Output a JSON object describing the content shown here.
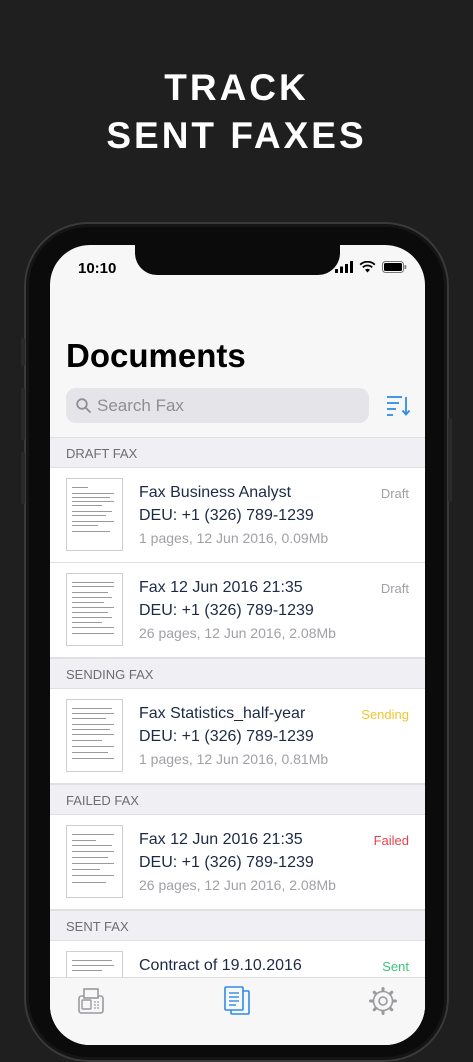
{
  "headline": {
    "line1": "TRACK",
    "line2": "SENT FAXES"
  },
  "status_bar": {
    "time": "10:10"
  },
  "header": {
    "title": "Documents"
  },
  "search": {
    "placeholder": "Search Fax"
  },
  "sections": [
    {
      "title": "DRAFT FAX",
      "rows": [
        {
          "name": "Fax Business Analyst",
          "number": "DEU: +1 (326) 789-1239",
          "meta": "1 pages, 12 Jun 2016, 0.09Mb",
          "status": "Draft",
          "status_color": "#a0a0a6"
        },
        {
          "name": "Fax 12 Jun 2016 21:35",
          "number": "DEU: +1 (326) 789-1239",
          "meta": "26 pages, 12 Jun 2016, 2.08Mb",
          "status": "Draft",
          "status_color": "#a0a0a6"
        }
      ]
    },
    {
      "title": "SENDING FAX",
      "rows": [
        {
          "name": "Fax Statistics_half-year",
          "number": "DEU: +1 (326) 789-1239",
          "meta": "1 pages, 12 Jun 2016, 0.81Mb",
          "status": "Sending",
          "status_color": "#f3c531"
        }
      ]
    },
    {
      "title": "FAILED FAX",
      "rows": [
        {
          "name": "Fax 12 Jun 2016 21:35",
          "number": "DEU: +1 (326) 789-1239",
          "meta": "26 pages, 12 Jun 2016, 2.08Mb",
          "status": "Failed",
          "status_color": "#e8414c"
        }
      ]
    },
    {
      "title": "SENT FAX",
      "rows": [
        {
          "name": "Contract of 19.10.2016",
          "number": "",
          "meta": "",
          "status": "Sent",
          "status_color": "#3bc37a"
        }
      ]
    }
  ],
  "colors": {
    "accent": "#2f8be6",
    "background": "#1f1f1f"
  },
  "tab_bar": {
    "tabs": [
      {
        "icon": "fax-machine-icon",
        "active": false
      },
      {
        "icon": "documents-icon",
        "active": true
      },
      {
        "icon": "gear-icon",
        "active": false
      }
    ]
  }
}
